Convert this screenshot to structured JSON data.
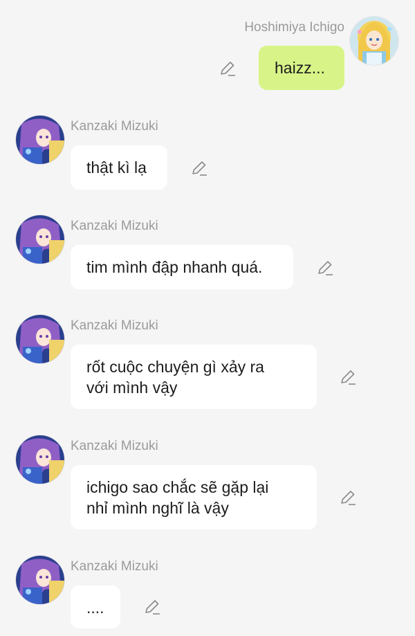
{
  "messages": [
    {
      "sender": "Hoshimiya Ichigo",
      "text": "haizz...",
      "side": "right",
      "avatar": "ichigo-avatar"
    },
    {
      "sender": "Kanzaki Mizuki",
      "text": "thật kì lạ",
      "side": "left",
      "avatar": "mizuki-avatar"
    },
    {
      "sender": "Kanzaki Mizuki",
      "text": "tim mình đập nhanh quá.",
      "side": "left",
      "avatar": "mizuki-avatar"
    },
    {
      "sender": "Kanzaki Mizuki",
      "text": "rốt cuộc chuyện gì xảy ra\nvới mình vậy",
      "side": "left",
      "avatar": "mizuki-avatar"
    },
    {
      "sender": "Kanzaki Mizuki",
      "text": "ichigo sao chắc sẽ gặp lại\nnhỉ mình nghĩ là vậy",
      "side": "left",
      "avatar": "mizuki-avatar"
    },
    {
      "sender": "Kanzaki Mizuki",
      "text": "....",
      "side": "left",
      "avatar": "mizuki-avatar"
    }
  ],
  "colors": {
    "background": "#f5f5f5",
    "own_bubble": "#d8f488",
    "other_bubble": "#ffffff",
    "sender_text": "#9a9a9a",
    "edit_icon": "#8a8a8a"
  },
  "icons": {
    "edit": "pencil-edit-icon"
  }
}
